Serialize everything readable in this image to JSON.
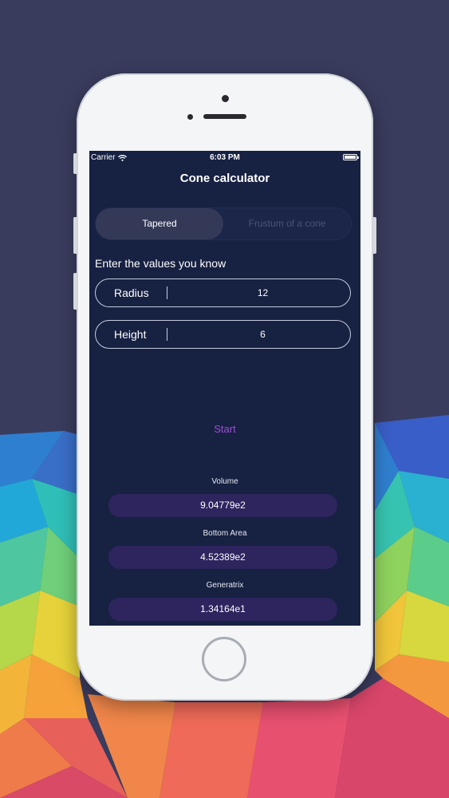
{
  "status_bar": {
    "carrier": "Carrier",
    "time": "6:03 PM",
    "wifi_icon": "wifi-icon",
    "battery_icon": "battery-icon"
  },
  "nav": {
    "title": "Cone calculator"
  },
  "segment": {
    "options": [
      "Tapered",
      "Frustum of a cone"
    ],
    "selected": "Tapered"
  },
  "prompt": "Enter the values you know",
  "fields": [
    {
      "label": "Radius",
      "value": "12"
    },
    {
      "label": "Height",
      "value": "6"
    }
  ],
  "start_label": "Start",
  "results": [
    {
      "label": "Volume",
      "value": "9.04779e2"
    },
    {
      "label": "Bottom Area",
      "value": "4.52389e2"
    },
    {
      "label": "Generatrix",
      "value": "1.34164e1"
    }
  ],
  "colors": {
    "page_bg": "#3a3c5e",
    "screen_bg": "#172142",
    "accent": "#9d4ed6",
    "result_box": "#2e245e"
  }
}
